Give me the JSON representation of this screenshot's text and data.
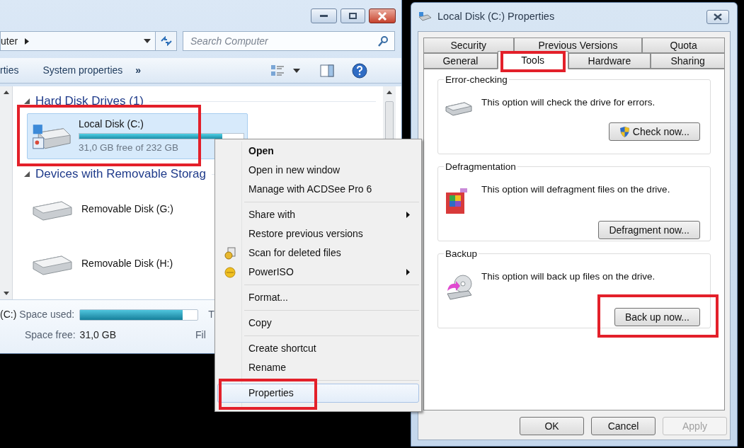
{
  "explorer": {
    "address": "uter",
    "search": {
      "placeholder": "Search Computer"
    },
    "toolbar": [
      "rties",
      "System properties",
      "»"
    ],
    "groups": [
      {
        "title": "Hard Disk Drives (1)",
        "expanded": true,
        "items": [
          {
            "kind": "hard_disk",
            "name": "Local Disk (C:)",
            "level": 0.87,
            "info": "31,0 GB free of 232 GB",
            "selected": true,
            "highlighted": true
          }
        ]
      },
      {
        "title": "Devices with Removable Storag",
        "expanded": true,
        "items": [
          {
            "kind": "removable",
            "name": "Removable Disk (G:)",
            "selected": false,
            "highlighted": false
          },
          {
            "kind": "removable",
            "name": "Removable Disk (H:)",
            "selected": false,
            "highlighted": false
          }
        ]
      }
    ],
    "details": {
      "drive": "(C:)",
      "used_label": "Space used:",
      "level": 0.87,
      "column_3": "T",
      "free_label": "Space free:",
      "free_value": "31,0 GB",
      "column_4": "Fil"
    }
  },
  "context_menu": [
    {
      "kind": "item",
      "label": "Open",
      "default": true,
      "submenu": false,
      "selected": false,
      "highlighted": false
    },
    {
      "kind": "item",
      "label": "Open in new window",
      "default": false,
      "submenu": false,
      "selected": false,
      "highlighted": false
    },
    {
      "kind": "item",
      "label": "Manage with ACDSee Pro 6",
      "default": false,
      "submenu": false,
      "selected": false,
      "highlighted": false
    },
    {
      "kind": "separator"
    },
    {
      "kind": "item",
      "label": "Share with",
      "default": false,
      "submenu": true,
      "selected": false,
      "highlighted": false
    },
    {
      "kind": "item",
      "label": "Restore previous versions",
      "default": false,
      "submenu": false,
      "selected": false,
      "highlighted": false
    },
    {
      "kind": "scan_item",
      "label": "Scan for deleted files",
      "default": false,
      "submenu": false,
      "selected": false,
      "highlighted": false
    },
    {
      "kind": "disc_item",
      "label": "PowerISO",
      "default": false,
      "submenu": true,
      "selected": false,
      "highlighted": false
    },
    {
      "kind": "separator"
    },
    {
      "kind": "item",
      "label": "Format...",
      "default": false,
      "submenu": false,
      "selected": false,
      "highlighted": false
    },
    {
      "kind": "separator"
    },
    {
      "kind": "item",
      "label": "Copy",
      "default": false,
      "submenu": false,
      "selected": false,
      "highlighted": false
    },
    {
      "kind": "separator"
    },
    {
      "kind": "item",
      "label": "Create shortcut",
      "default": false,
      "submenu": false,
      "selected": false,
      "highlighted": false
    },
    {
      "kind": "item",
      "label": "Rename",
      "default": false,
      "submenu": false,
      "selected": false,
      "highlighted": false
    },
    {
      "kind": "separator"
    },
    {
      "kind": "item",
      "label": "Properties",
      "default": false,
      "submenu": false,
      "selected": true,
      "highlighted": true
    }
  ],
  "dialog": {
    "title": "Local Disk (C:) Properties",
    "tab_rows": [
      [
        {
          "label": "Security",
          "selected": false,
          "highlighted": false
        },
        {
          "label": "Previous Versions",
          "selected": false,
          "highlighted": false
        },
        {
          "label": "Quota",
          "selected": false,
          "highlighted": false
        }
      ],
      [
        {
          "label": "General",
          "selected": false,
          "highlighted": false
        },
        {
          "label": "Tools",
          "selected": true,
          "highlighted": true
        },
        {
          "label": "Hardware",
          "selected": false,
          "highlighted": false
        },
        {
          "label": "Sharing",
          "selected": false,
          "highlighted": false
        }
      ]
    ],
    "sections": [
      {
        "kind": "error_checking",
        "title": "Error-checking",
        "text": "This option will check the drive for errors.",
        "button": "Check now...",
        "shield": true,
        "highlighted": false
      },
      {
        "kind": "defragmentation",
        "title": "Defragmentation",
        "text": "This option will defragment files on the drive.",
        "button": "Defragment now...",
        "shield": false,
        "highlighted": false
      },
      {
        "kind": "backup",
        "title": "Backup",
        "text": "This option will back up files on the drive.",
        "button": "Back up now...",
        "shield": false,
        "highlighted": true
      }
    ],
    "buttons": [
      {
        "label": "OK",
        "disabled": false
      },
      {
        "label": "Cancel",
        "disabled": false
      },
      {
        "label": "Apply",
        "disabled": true
      }
    ]
  }
}
